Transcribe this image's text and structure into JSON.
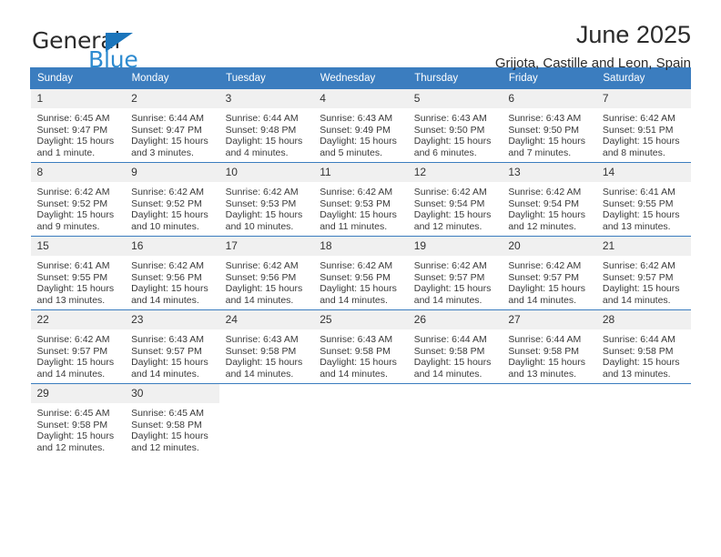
{
  "brand": {
    "name_top": "General",
    "name_bottom": "Blue",
    "triangle_color": "#1b75bb",
    "blue_text_color": "#2e8bd0"
  },
  "header": {
    "title": "June 2025",
    "subtitle": "Grijota, Castille and Leon, Spain"
  },
  "colors": {
    "header_row_bg": "#3b7dbf",
    "header_row_text": "#ffffff",
    "daynum_bg": "#f0f0f0",
    "cell_bg": "#ffffff",
    "grid_line": "#3b7dbf",
    "body_text": "#3a3a3a"
  },
  "weekday_headers": [
    "Sunday",
    "Monday",
    "Tuesday",
    "Wednesday",
    "Thursday",
    "Friday",
    "Saturday"
  ],
  "weeks": [
    [
      {
        "day": "1",
        "sunrise": "Sunrise: 6:45 AM",
        "sunset": "Sunset: 9:47 PM",
        "daylight": "Daylight: 15 hours and 1 minute."
      },
      {
        "day": "2",
        "sunrise": "Sunrise: 6:44 AM",
        "sunset": "Sunset: 9:47 PM",
        "daylight": "Daylight: 15 hours and 3 minutes."
      },
      {
        "day": "3",
        "sunrise": "Sunrise: 6:44 AM",
        "sunset": "Sunset: 9:48 PM",
        "daylight": "Daylight: 15 hours and 4 minutes."
      },
      {
        "day": "4",
        "sunrise": "Sunrise: 6:43 AM",
        "sunset": "Sunset: 9:49 PM",
        "daylight": "Daylight: 15 hours and 5 minutes."
      },
      {
        "day": "5",
        "sunrise": "Sunrise: 6:43 AM",
        "sunset": "Sunset: 9:50 PM",
        "daylight": "Daylight: 15 hours and 6 minutes."
      },
      {
        "day": "6",
        "sunrise": "Sunrise: 6:43 AM",
        "sunset": "Sunset: 9:50 PM",
        "daylight": "Daylight: 15 hours and 7 minutes."
      },
      {
        "day": "7",
        "sunrise": "Sunrise: 6:42 AM",
        "sunset": "Sunset: 9:51 PM",
        "daylight": "Daylight: 15 hours and 8 minutes."
      }
    ],
    [
      {
        "day": "8",
        "sunrise": "Sunrise: 6:42 AM",
        "sunset": "Sunset: 9:52 PM",
        "daylight": "Daylight: 15 hours and 9 minutes."
      },
      {
        "day": "9",
        "sunrise": "Sunrise: 6:42 AM",
        "sunset": "Sunset: 9:52 PM",
        "daylight": "Daylight: 15 hours and 10 minutes."
      },
      {
        "day": "10",
        "sunrise": "Sunrise: 6:42 AM",
        "sunset": "Sunset: 9:53 PM",
        "daylight": "Daylight: 15 hours and 10 minutes."
      },
      {
        "day": "11",
        "sunrise": "Sunrise: 6:42 AM",
        "sunset": "Sunset: 9:53 PM",
        "daylight": "Daylight: 15 hours and 11 minutes."
      },
      {
        "day": "12",
        "sunrise": "Sunrise: 6:42 AM",
        "sunset": "Sunset: 9:54 PM",
        "daylight": "Daylight: 15 hours and 12 minutes."
      },
      {
        "day": "13",
        "sunrise": "Sunrise: 6:42 AM",
        "sunset": "Sunset: 9:54 PM",
        "daylight": "Daylight: 15 hours and 12 minutes."
      },
      {
        "day": "14",
        "sunrise": "Sunrise: 6:41 AM",
        "sunset": "Sunset: 9:55 PM",
        "daylight": "Daylight: 15 hours and 13 minutes."
      }
    ],
    [
      {
        "day": "15",
        "sunrise": "Sunrise: 6:41 AM",
        "sunset": "Sunset: 9:55 PM",
        "daylight": "Daylight: 15 hours and 13 minutes."
      },
      {
        "day": "16",
        "sunrise": "Sunrise: 6:42 AM",
        "sunset": "Sunset: 9:56 PM",
        "daylight": "Daylight: 15 hours and 14 minutes."
      },
      {
        "day": "17",
        "sunrise": "Sunrise: 6:42 AM",
        "sunset": "Sunset: 9:56 PM",
        "daylight": "Daylight: 15 hours and 14 minutes."
      },
      {
        "day": "18",
        "sunrise": "Sunrise: 6:42 AM",
        "sunset": "Sunset: 9:56 PM",
        "daylight": "Daylight: 15 hours and 14 minutes."
      },
      {
        "day": "19",
        "sunrise": "Sunrise: 6:42 AM",
        "sunset": "Sunset: 9:57 PM",
        "daylight": "Daylight: 15 hours and 14 minutes."
      },
      {
        "day": "20",
        "sunrise": "Sunrise: 6:42 AM",
        "sunset": "Sunset: 9:57 PM",
        "daylight": "Daylight: 15 hours and 14 minutes."
      },
      {
        "day": "21",
        "sunrise": "Sunrise: 6:42 AM",
        "sunset": "Sunset: 9:57 PM",
        "daylight": "Daylight: 15 hours and 14 minutes."
      }
    ],
    [
      {
        "day": "22",
        "sunrise": "Sunrise: 6:42 AM",
        "sunset": "Sunset: 9:57 PM",
        "daylight": "Daylight: 15 hours and 14 minutes."
      },
      {
        "day": "23",
        "sunrise": "Sunrise: 6:43 AM",
        "sunset": "Sunset: 9:57 PM",
        "daylight": "Daylight: 15 hours and 14 minutes."
      },
      {
        "day": "24",
        "sunrise": "Sunrise: 6:43 AM",
        "sunset": "Sunset: 9:58 PM",
        "daylight": "Daylight: 15 hours and 14 minutes."
      },
      {
        "day": "25",
        "sunrise": "Sunrise: 6:43 AM",
        "sunset": "Sunset: 9:58 PM",
        "daylight": "Daylight: 15 hours and 14 minutes."
      },
      {
        "day": "26",
        "sunrise": "Sunrise: 6:44 AM",
        "sunset": "Sunset: 9:58 PM",
        "daylight": "Daylight: 15 hours and 14 minutes."
      },
      {
        "day": "27",
        "sunrise": "Sunrise: 6:44 AM",
        "sunset": "Sunset: 9:58 PM",
        "daylight": "Daylight: 15 hours and 13 minutes."
      },
      {
        "day": "28",
        "sunrise": "Sunrise: 6:44 AM",
        "sunset": "Sunset: 9:58 PM",
        "daylight": "Daylight: 15 hours and 13 minutes."
      }
    ],
    [
      {
        "day": "29",
        "sunrise": "Sunrise: 6:45 AM",
        "sunset": "Sunset: 9:58 PM",
        "daylight": "Daylight: 15 hours and 12 minutes."
      },
      {
        "day": "30",
        "sunrise": "Sunrise: 6:45 AM",
        "sunset": "Sunset: 9:58 PM",
        "daylight": "Daylight: 15 hours and 12 minutes."
      },
      {
        "day": "",
        "sunrise": "",
        "sunset": "",
        "daylight": ""
      },
      {
        "day": "",
        "sunrise": "",
        "sunset": "",
        "daylight": ""
      },
      {
        "day": "",
        "sunrise": "",
        "sunset": "",
        "daylight": ""
      },
      {
        "day": "",
        "sunrise": "",
        "sunset": "",
        "daylight": ""
      },
      {
        "day": "",
        "sunrise": "",
        "sunset": "",
        "daylight": ""
      }
    ]
  ]
}
